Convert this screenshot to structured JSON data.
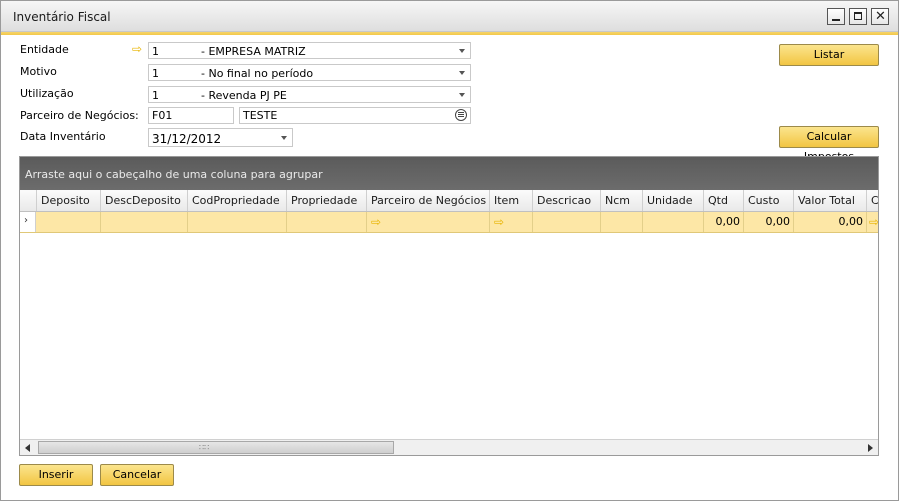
{
  "window": {
    "title": "Inventário Fiscal"
  },
  "form": {
    "entidade": {
      "label": "Entidade",
      "code": "1",
      "desc": "- EMPRESA MATRIZ"
    },
    "motivo": {
      "label": "Motivo",
      "code": "1",
      "desc": "- No final no período"
    },
    "utilizacao": {
      "label": "Utilização",
      "code": "1",
      "desc": "- Revenda PJ PE"
    },
    "parceiro": {
      "label": "Parceiro de Negócios:",
      "code": "F01",
      "name": "TESTE"
    },
    "data": {
      "label": "Data Inventário",
      "value": "31/12/2012"
    }
  },
  "buttons": {
    "listar": "Listar",
    "calcular": "Calcular Impostos",
    "inserir": "Inserir",
    "cancelar": "Cancelar"
  },
  "grid": {
    "group_hint": "Arraste aqui o cabeçalho de uma coluna para agrupar",
    "columns": [
      "Deposito",
      "DescDeposito",
      "CodPropriedade",
      "Propriedade",
      "Parceiro de Negócios",
      "Item",
      "Descricao",
      "Ncm",
      "Unidade",
      "Qtd",
      "Custo",
      "Valor Total",
      "C"
    ],
    "row": {
      "qtd": "0,00",
      "custo": "0,00",
      "valor_total": "0,00"
    },
    "scroll_grip": "∷∷"
  },
  "icons": {
    "link": "link-arrow-icon",
    "list": "list-icon",
    "row_indicator": "row-indicator-icon"
  },
  "colors": {
    "accent": "#f2c849",
    "row_selected": "#fde7a6",
    "group_bar": "#5b5b5b"
  }
}
